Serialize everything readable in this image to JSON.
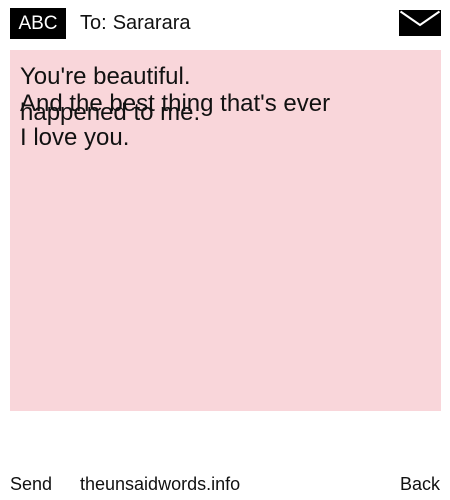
{
  "header": {
    "badge_label": "ABC",
    "recipient_prefix": "To:",
    "recipient_name": "Sararara",
    "mail_icon": "envelope-icon"
  },
  "message": {
    "lines": [
      "You're beautiful.",
      "And the best thing that's ever",
      "happened to me.",
      "I love you."
    ],
    "background_color": "#f9d6da"
  },
  "footer": {
    "send_label": "Send",
    "site_label": "theunsaidwords.info",
    "back_label": "Back"
  }
}
